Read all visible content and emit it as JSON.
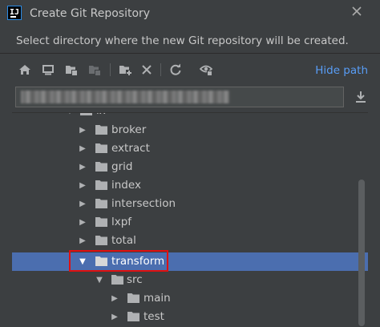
{
  "window": {
    "title": "Create Git Repository",
    "subtitle": "Select directory where the new Git repository will be created."
  },
  "toolbar": {
    "buttons": [
      "home-icon",
      "desktop-icon",
      "project-folder-icon",
      "module-folder-icon",
      "new-folder-icon",
      "delete-icon",
      "refresh-icon",
      "show-hidden-icon"
    ],
    "hide_path_label": "Hide path"
  },
  "path_field": {
    "value": "██████████████████████████████████████"
  },
  "tree": {
    "partial_top_label": "lx",
    "items": [
      {
        "label": "broker",
        "expanded": false,
        "depth": 1
      },
      {
        "label": "extract",
        "expanded": false,
        "depth": 1
      },
      {
        "label": "grid",
        "expanded": false,
        "depth": 1
      },
      {
        "label": "index",
        "expanded": false,
        "depth": 1
      },
      {
        "label": "intersection",
        "expanded": false,
        "depth": 1
      },
      {
        "label": "lxpf",
        "expanded": false,
        "depth": 1
      },
      {
        "label": "total",
        "expanded": false,
        "depth": 1
      },
      {
        "label": "transform",
        "expanded": true,
        "depth": 1,
        "selected": true
      },
      {
        "label": "src",
        "expanded": true,
        "depth": 2
      },
      {
        "label": "main",
        "expanded": false,
        "depth": 3
      },
      {
        "label": "test",
        "expanded": false,
        "depth": 3
      }
    ]
  },
  "colors": {
    "background": "#3c3f41",
    "selection": "#4b6eaf",
    "link": "#589df6",
    "folder": "#afb1b3",
    "highlight_box": "#e01010"
  }
}
